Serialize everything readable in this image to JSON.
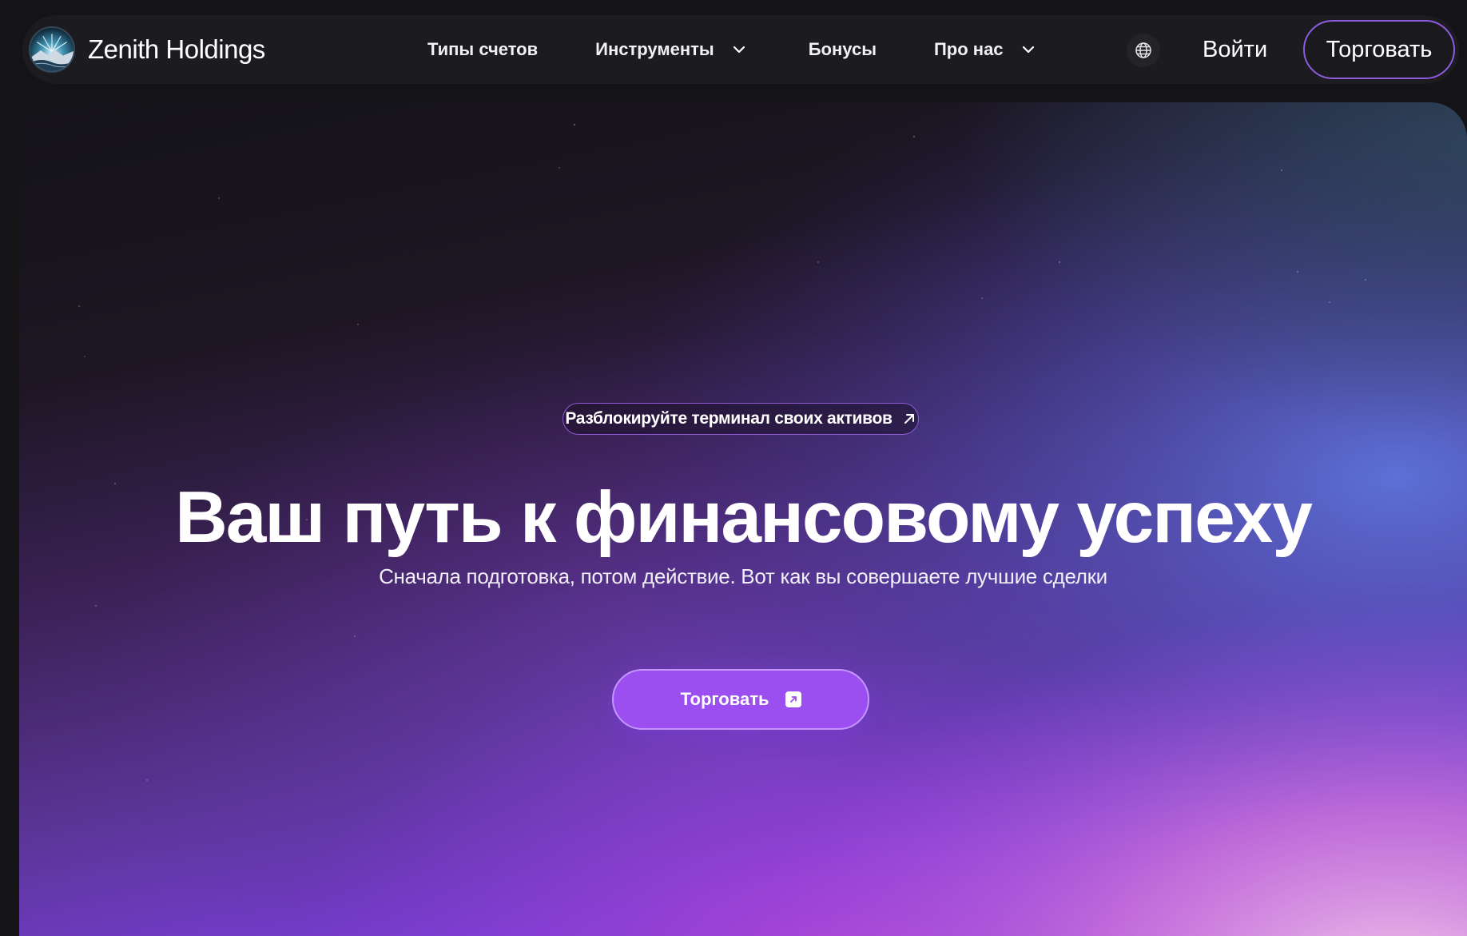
{
  "brand": {
    "name": "Zenith Holdings",
    "logo_icon": "mountain-sunrise-logo"
  },
  "nav": {
    "items": [
      {
        "label": "Типы счетов",
        "has_dropdown": false
      },
      {
        "label": "Инструменты",
        "has_dropdown": true
      },
      {
        "label": "Бонусы",
        "has_dropdown": false
      },
      {
        "label": "Про нас",
        "has_dropdown": true
      }
    ],
    "language_icon": "globe-icon",
    "login_label": "Войти",
    "trade_label": "Торговать"
  },
  "hero": {
    "pill_label": "Разблокируйте терминал своих активов",
    "pill_icon": "arrow-up-right-icon",
    "headline": "Ваш путь к финансовому успеху",
    "subheadline": "Сначала подготовка, потом действие. Вот как вы совершаете лучшие сделки",
    "cta_label": "Торговать",
    "cta_icon": "external-link-icon"
  },
  "colors": {
    "page_background": "#141417",
    "nav_background": "#1c1c20",
    "accent_purple": "#9b4ff0",
    "accent_border": "#8c5ce0",
    "gradient_blue": "#5f6fd8",
    "gradient_pink": "#e09ad8"
  }
}
